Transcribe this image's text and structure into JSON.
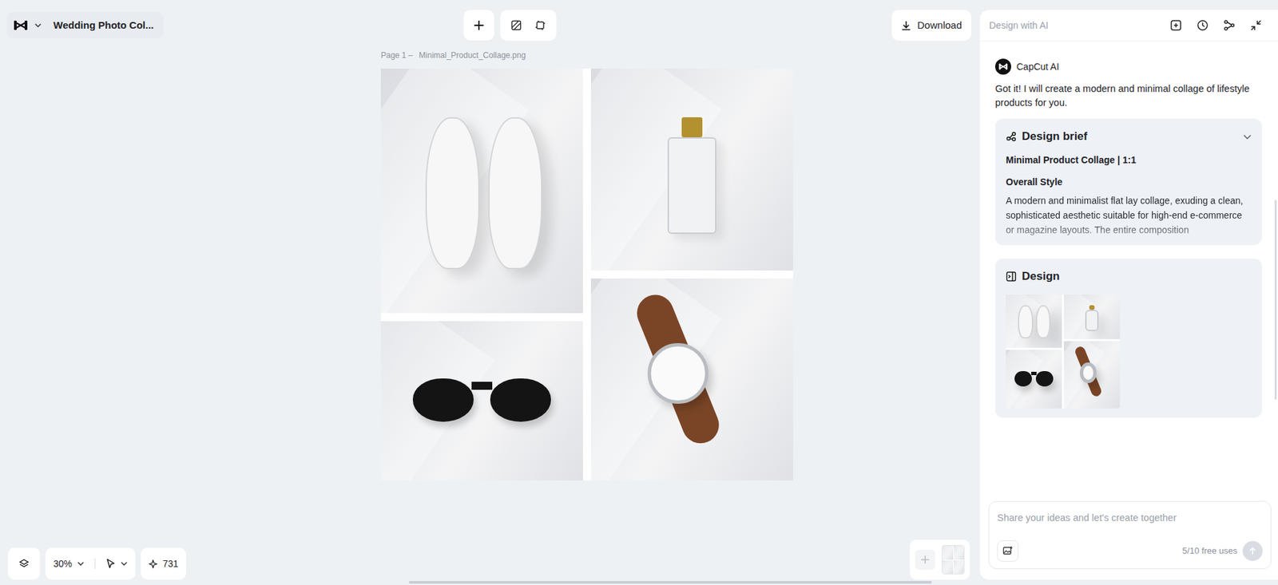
{
  "document": {
    "title": "Wedding Photo Col..."
  },
  "toolbar": {
    "download": "Download"
  },
  "canvas": {
    "page_label": "Page 1 –",
    "file_name": "Minimal_Product_Collage.png"
  },
  "status_bar": {
    "zoom": "30%",
    "credits": "731"
  },
  "ai_panel": {
    "title": "Design with AI",
    "message": {
      "sender": "CapCut AI",
      "text": "Got it! I will create a modern and minimal collage of lifestyle products for you."
    },
    "brief": {
      "heading": "Design brief",
      "expanded": true,
      "title": "Minimal Product Collage | 1:1",
      "section": "Overall Style",
      "text": "A modern and minimalist flat lay collage, exuding a clean, sophisticated aesthetic suitable for high-end e-commerce or magazine layouts. The entire composition"
    },
    "design": {
      "heading": "Design"
    },
    "input": {
      "placeholder": "Share your ideas and let's create together",
      "usage": "5/10 free uses",
      "send_enabled": false
    }
  }
}
